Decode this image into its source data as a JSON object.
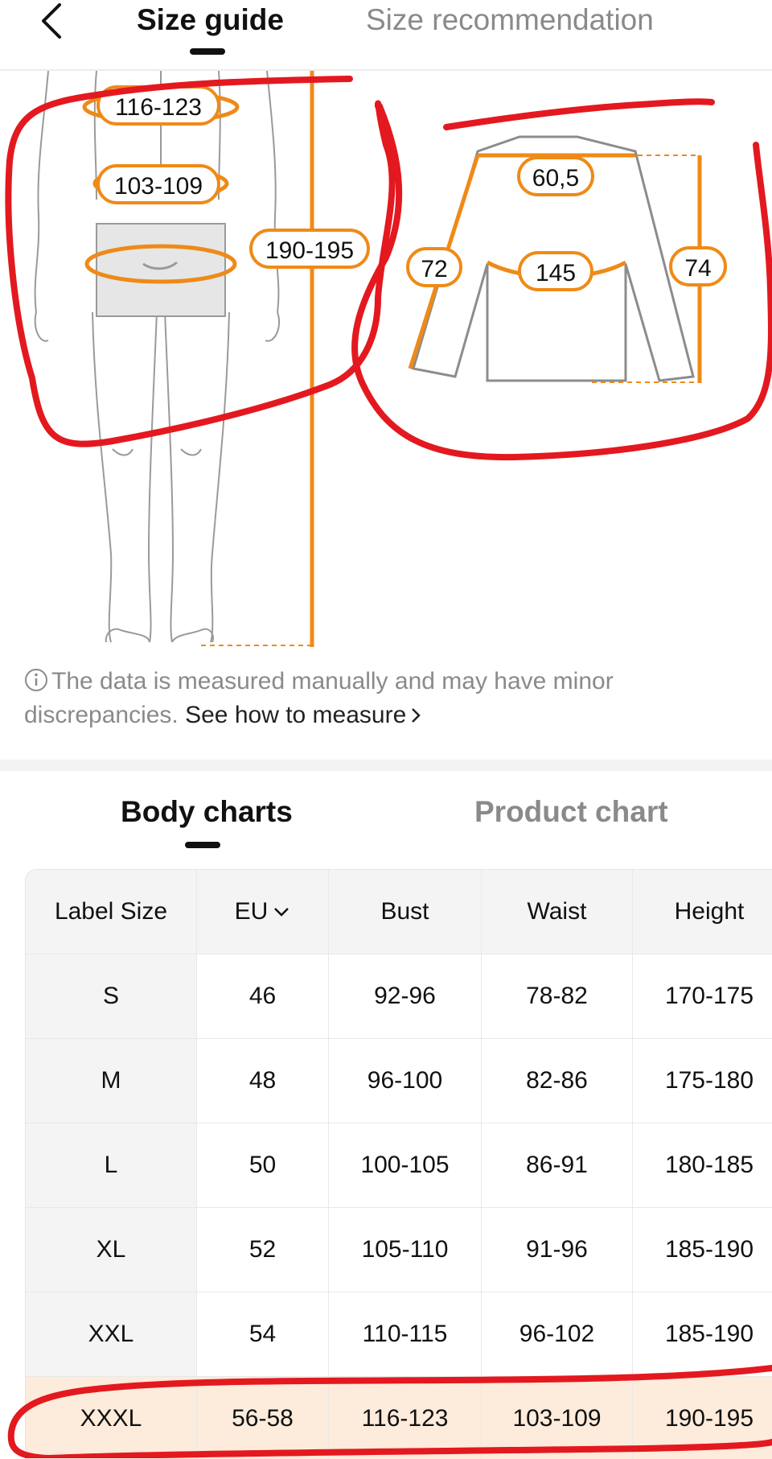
{
  "header": {
    "tabs": [
      {
        "label": "Size guide",
        "active": true
      },
      {
        "label": "Size recommendation",
        "active": false
      }
    ]
  },
  "illustration": {
    "body": {
      "chest": "116-123",
      "waist": "103-109",
      "height": "190-195"
    },
    "garment": {
      "shoulder": "60,5",
      "sleeve": "72",
      "chest": "145",
      "length": "74"
    }
  },
  "notice": {
    "text": "The data is measured manually and may have minor discrepancies.",
    "link": "See how to measure"
  },
  "chart_tabs": [
    {
      "label": "Body charts",
      "active": true
    },
    {
      "label": "Product chart",
      "active": false
    }
  ],
  "table": {
    "headers": [
      "Label Size",
      "EU",
      "Bust",
      "Waist",
      "Height"
    ],
    "rows": [
      [
        "S",
        "46",
        "92-96",
        "78-82",
        "170-175"
      ],
      [
        "M",
        "48",
        "96-100",
        "82-86",
        "175-180"
      ],
      [
        "L",
        "50",
        "100-105",
        "86-91",
        "180-185"
      ],
      [
        "XL",
        "52",
        "105-110",
        "91-96",
        "185-190"
      ],
      [
        "XXL",
        "54",
        "110-115",
        "96-102",
        "185-190"
      ],
      [
        "XXXL",
        "56-58",
        "116-123",
        "103-109",
        "190-195"
      ]
    ],
    "highlighted_row": "XXXL"
  },
  "colors": {
    "accent": "#ef8a17",
    "annotation": "#e3191f",
    "highlight_row": "#fdebdb"
  }
}
